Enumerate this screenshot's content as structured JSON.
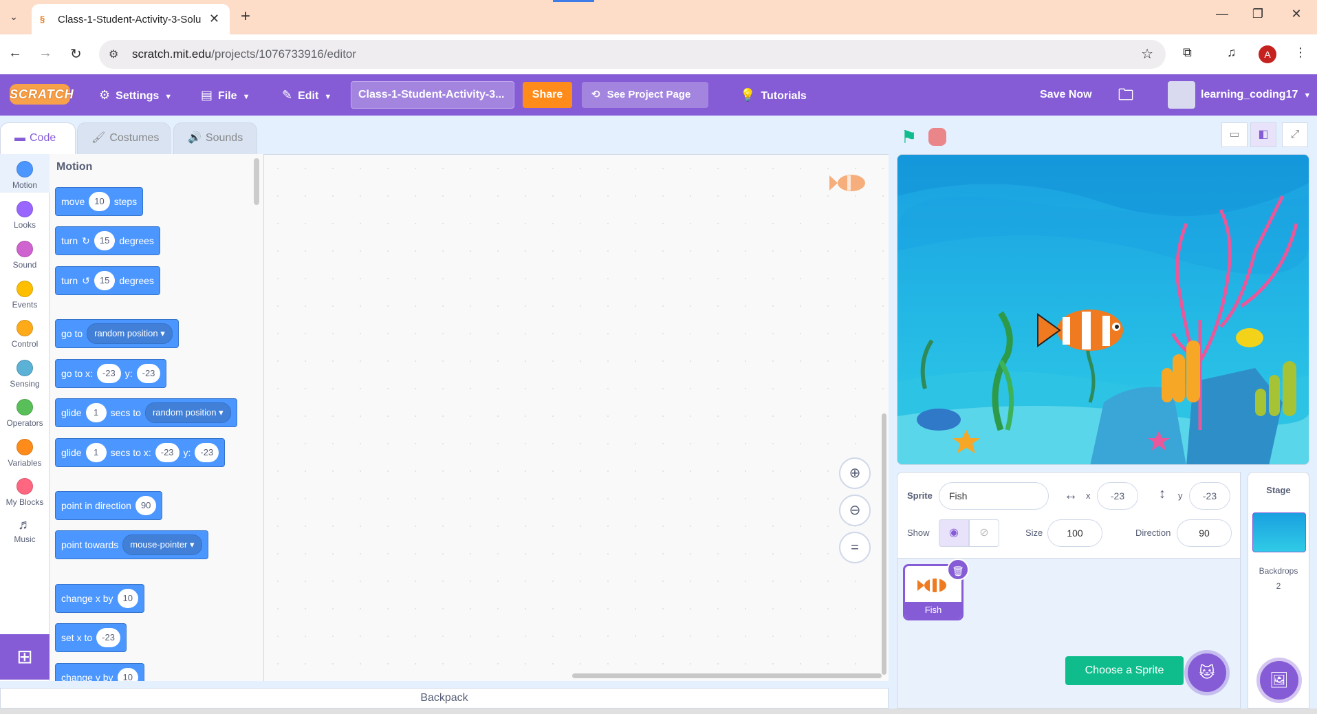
{
  "browser": {
    "tab_title": "Class-1-Student-Activity-3-Solu",
    "url_domain": "scratch.mit.edu",
    "url_path": "/projects/1076733916/editor",
    "profile_initial": "A"
  },
  "menu": {
    "logo": "SCRATCH",
    "settings": "Settings",
    "file": "File",
    "edit": "Edit",
    "project_title": "Class-1-Student-Activity-3...",
    "share": "Share",
    "see_project_page": "See Project Page",
    "tutorials": "Tutorials",
    "save_now": "Save Now",
    "username": "learning_coding17"
  },
  "tabs": {
    "code": "Code",
    "costumes": "Costumes",
    "sounds": "Sounds"
  },
  "categories": [
    {
      "label": "Motion",
      "color": "#4c97ff"
    },
    {
      "label": "Looks",
      "color": "#9966ff"
    },
    {
      "label": "Sound",
      "color": "#cf63cf"
    },
    {
      "label": "Events",
      "color": "#ffbf00"
    },
    {
      "label": "Control",
      "color": "#ffab19"
    },
    {
      "label": "Sensing",
      "color": "#5cb1d6"
    },
    {
      "label": "Operators",
      "color": "#59c059"
    },
    {
      "label": "Variables",
      "color": "#ff8c1a"
    },
    {
      "label": "My Blocks",
      "color": "#ff6680"
    },
    {
      "label": "Music",
      "color": ""
    }
  ],
  "palette": {
    "heading": "Motion",
    "blocks": {
      "move": {
        "a": "move",
        "v": "10",
        "b": "steps"
      },
      "turn_right": {
        "a": "turn",
        "v": "15",
        "b": "degrees"
      },
      "turn_left": {
        "a": "turn",
        "v": "15",
        "b": "degrees"
      },
      "goto": {
        "a": "go to",
        "dd": "random position"
      },
      "gotoxy": {
        "a": "go to x:",
        "x": "-23",
        "b": "y:",
        "y": "-23"
      },
      "glide": {
        "a": "glide",
        "v": "1",
        "b": "secs to",
        "dd": "random position"
      },
      "glidexy": {
        "a": "glide",
        "v": "1",
        "b": "secs to x:",
        "x": "-23",
        "c": "y:",
        "y": "-23"
      },
      "point_dir": {
        "a": "point in direction",
        "v": "90"
      },
      "point_towards": {
        "a": "point towards",
        "dd": "mouse-pointer"
      },
      "changex": {
        "a": "change x by",
        "v": "10"
      },
      "setx": {
        "a": "set x to",
        "v": "-23"
      },
      "changey": {
        "a": "change y by",
        "v": "10"
      }
    }
  },
  "code_area": {
    "zoom_reset": "="
  },
  "backpack": "Backpack",
  "sprite_info": {
    "sprite_label": "Sprite",
    "sprite_name": "Fish",
    "x_label": "x",
    "x": "-23",
    "y_label": "y",
    "y": "-23",
    "show_label": "Show",
    "size_label": "Size",
    "size": "100",
    "direction_label": "Direction",
    "direction": "90"
  },
  "sprites": [
    {
      "name": "Fish"
    }
  ],
  "choose_sprite": "Choose a Sprite",
  "stage_panel": {
    "title": "Stage",
    "backdrops_label": "Backdrops",
    "backdrops_count": "2"
  }
}
